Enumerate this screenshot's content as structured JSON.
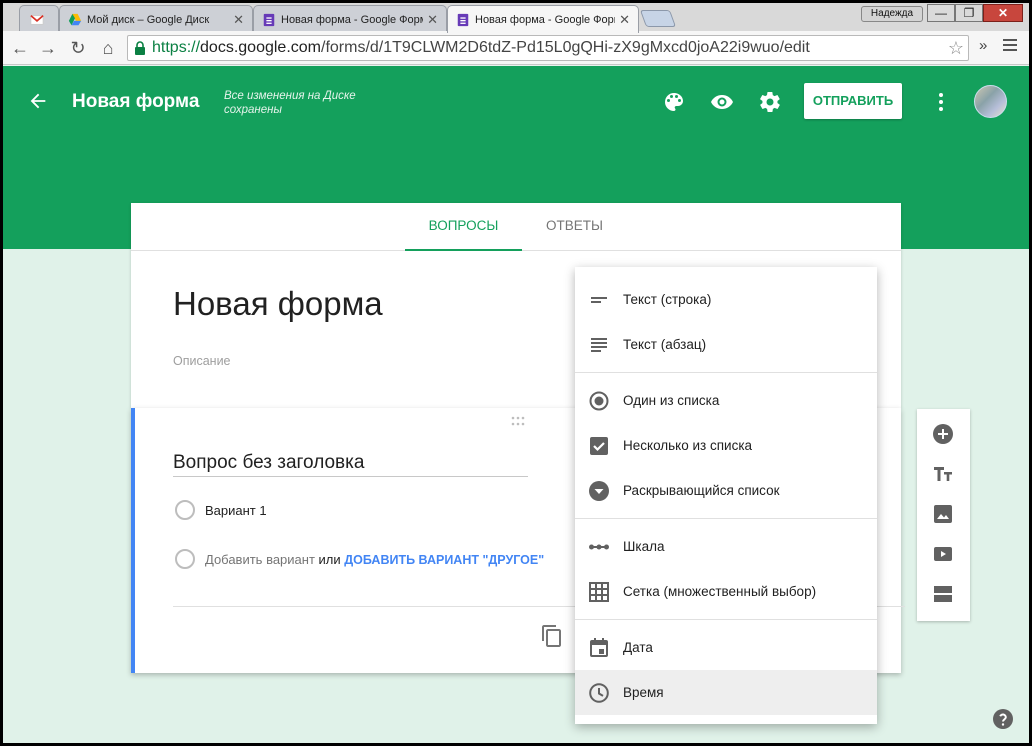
{
  "browser": {
    "tabs": [
      {
        "title": ""
      },
      {
        "title": "Мой диск – Google Диск"
      },
      {
        "title": "Новая форма - Google Форм"
      },
      {
        "title": "Новая форма - Google Форм"
      }
    ],
    "user_button": "Надежда",
    "url_scheme": "https://",
    "url_host": "docs.google.com",
    "url_path": "/forms/d/1T9CLWM2D6tdZ-Pd15L0gQHi-zX9gMxcd0joA22i9wuo/edit"
  },
  "header": {
    "title": "Новая форма",
    "saved_status": "Все изменения на Диске сохранены",
    "send_label": "ОТПРАВИТЬ",
    "color": "#14a05c"
  },
  "tabs": {
    "questions": "ВОПРОСЫ",
    "answers": "ОТВЕТЫ"
  },
  "form": {
    "title": "Новая форма",
    "description_placeholder": "Описание"
  },
  "question": {
    "title": "Вопрос без заголовка",
    "option1": "Вариант 1",
    "add_option": "Добавить вариант",
    "or": "или",
    "add_other": "ДОБАВИТЬ ВАРИАНТ \"ДРУГОЕ\""
  },
  "type_menu": {
    "items": [
      {
        "label": "Текст (строка)",
        "icon": "short-text-icon"
      },
      {
        "label": "Текст (абзац)",
        "icon": "paragraph-icon"
      },
      {
        "label": "Один из списка",
        "icon": "radio-icon"
      },
      {
        "label": "Несколько из списка",
        "icon": "checkbox-icon"
      },
      {
        "label": "Раскрывающийся список",
        "icon": "dropdown-icon"
      },
      {
        "label": "Шкала",
        "icon": "linear-scale-icon"
      },
      {
        "label": "Сетка (множественный выбор)",
        "icon": "grid-icon"
      },
      {
        "label": "Дата",
        "icon": "calendar-icon"
      },
      {
        "label": "Время",
        "icon": "clock-icon"
      }
    ]
  }
}
